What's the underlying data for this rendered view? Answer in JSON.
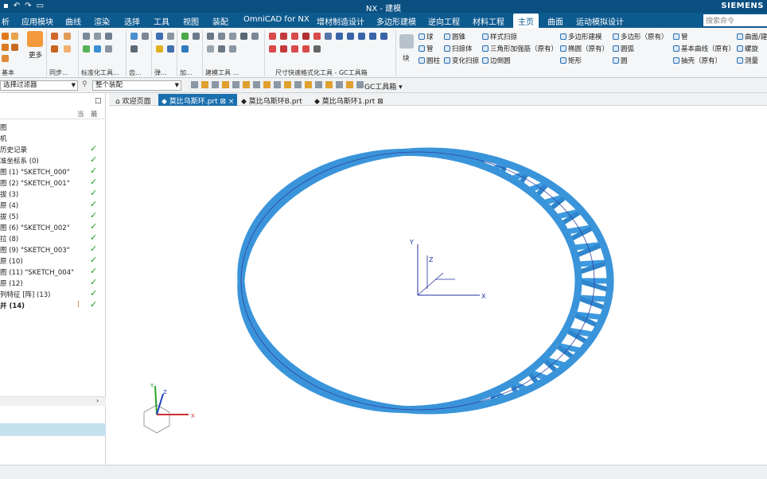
{
  "titlebar": {
    "title": "NX - 建模",
    "brand": "SIEMENS"
  },
  "menu": {
    "tabs": [
      "析",
      "应用模块",
      "曲线",
      "渲染",
      "选择",
      "工具",
      "视图",
      "装配",
      "OmniCAD for NX",
      "增材制造设计",
      "多边形建模",
      "逆向工程",
      "材料工程",
      "主页",
      "曲面",
      "运动模拟设计"
    ],
    "active": "主页",
    "search_placeholder": "搜索命令"
  },
  "ribbon": {
    "groups": [
      "基本",
      "同步...",
      "标准化工具...",
      "齿...",
      "弹...",
      "加...",
      "建模工具 ...",
      "尺寸快速格式化工具 - GC工具箱"
    ],
    "more_label": "更多",
    "block_label": "块",
    "commands": [
      [
        "球",
        "圆锥",
        "样式扫掠",
        "多边形建模",
        "多边形（原有）",
        "管",
        "曲面/建"
      ],
      [
        "管",
        "扫掠体",
        "三角形加强筋（原有）",
        "椭圆（原有）",
        "圆弧",
        "基本曲线（原有）",
        "螺旋"
      ],
      [
        "圆柱",
        "变化扫掠",
        "边倒圆",
        "矩形",
        "圆",
        "抽壳（原有）",
        "测量"
      ]
    ]
  },
  "filter": {
    "type_filter": "选择过滤器",
    "scope": "整个装配",
    "gc_toolbox": "GC工具箱"
  },
  "navigator": {
    "rows": [
      {
        "label": "图",
        "check": false,
        "mark": ""
      },
      {
        "label": "机",
        "check": false,
        "mark": ""
      },
      {
        "label": "历史记录",
        "check": true,
        "mark": ""
      },
      {
        "label": "准坐标系 (0)",
        "check": true,
        "mark": ""
      },
      {
        "label": "图 (1) \"SKETCH_000\"",
        "check": true,
        "mark": ""
      },
      {
        "label": "图 (2) \"SKETCH_001\"",
        "check": true,
        "mark": ""
      },
      {
        "label": "拔 (3)",
        "check": true,
        "mark": ""
      },
      {
        "label": "原 (4)",
        "check": true,
        "mark": ""
      },
      {
        "label": "拔 (5)",
        "check": true,
        "mark": ""
      },
      {
        "label": "图 (6) \"SKETCH_002\"",
        "check": true,
        "mark": ""
      },
      {
        "label": "拉 (8)",
        "check": true,
        "mark": ""
      },
      {
        "label": "图 (9) \"SKETCH_003\"",
        "check": true,
        "mark": ""
      },
      {
        "label": "原 (10)",
        "check": true,
        "mark": ""
      },
      {
        "label": "图 (11) \"SKETCH_004\"",
        "check": true,
        "mark": ""
      },
      {
        "label": "原 (12)",
        "check": true,
        "mark": ""
      },
      {
        "label": "列特征 [阵] (13)",
        "check": true,
        "mark": ""
      },
      {
        "label": "并 (14)",
        "check": true,
        "mark": "❘",
        "bold": true
      }
    ]
  },
  "documents": {
    "tabs": [
      "欢迎页面",
      "莫比乌斯环.prt",
      "莫比乌斯环B.prt",
      "莫比乌斯环1.prt"
    ],
    "active": 1
  },
  "viewport": {
    "axis_x": "X",
    "axis_y": "Y",
    "axis_z": "Z",
    "model_color": "#3d9ae0"
  }
}
